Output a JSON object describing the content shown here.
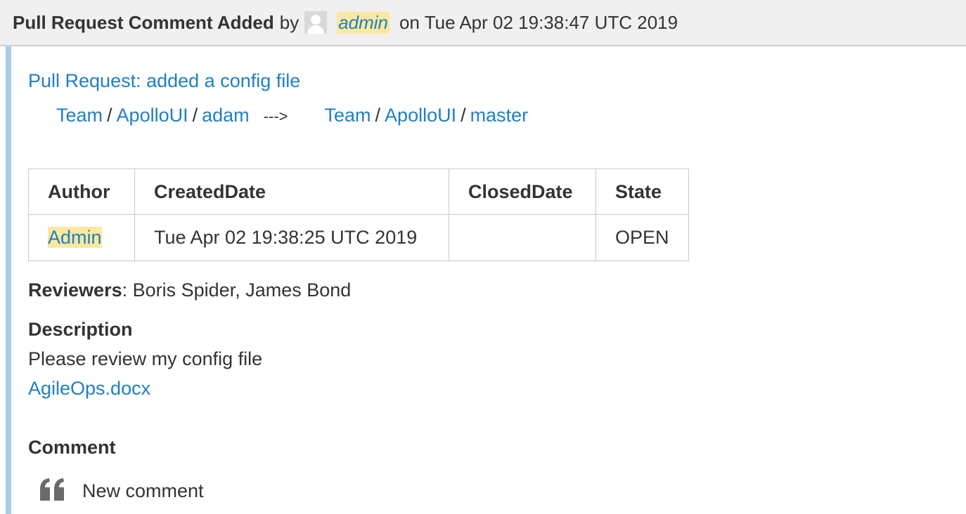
{
  "header": {
    "title": "Pull Request Comment Added",
    "by": "by",
    "user": "admin",
    "on_text": "on Tue Apr 02 19:38:47 UTC 2019"
  },
  "pull_request": {
    "title": "Pull Request: added a config file",
    "source": {
      "project": "Team",
      "repo": "ApolloUI",
      "branch": "adam"
    },
    "arrow": "--->",
    "target": {
      "project": "Team",
      "repo": "ApolloUI",
      "branch": "master"
    },
    "separator": "/"
  },
  "table": {
    "headers": [
      "Author",
      "CreatedDate",
      "ClosedDate",
      "State"
    ],
    "row": {
      "author": "Admin",
      "created": "Tue Apr 02 19:38:25 UTC 2019",
      "closed": "",
      "state": "OPEN"
    }
  },
  "reviewers": {
    "label": "Reviewers",
    "colon": ":",
    "names": "Boris Spider, James Bond"
  },
  "description": {
    "heading": "Description",
    "text": "Please review my config file",
    "attachment": "AgileOps.docx"
  },
  "comment": {
    "heading": "Comment",
    "text": "New comment",
    "icon": "quote-icon"
  },
  "colors": {
    "link": "#1f7fc4",
    "highlight": "#fce8a0",
    "accent_bar": "#a8cbe8",
    "header_bg": "#f0f0f0"
  }
}
